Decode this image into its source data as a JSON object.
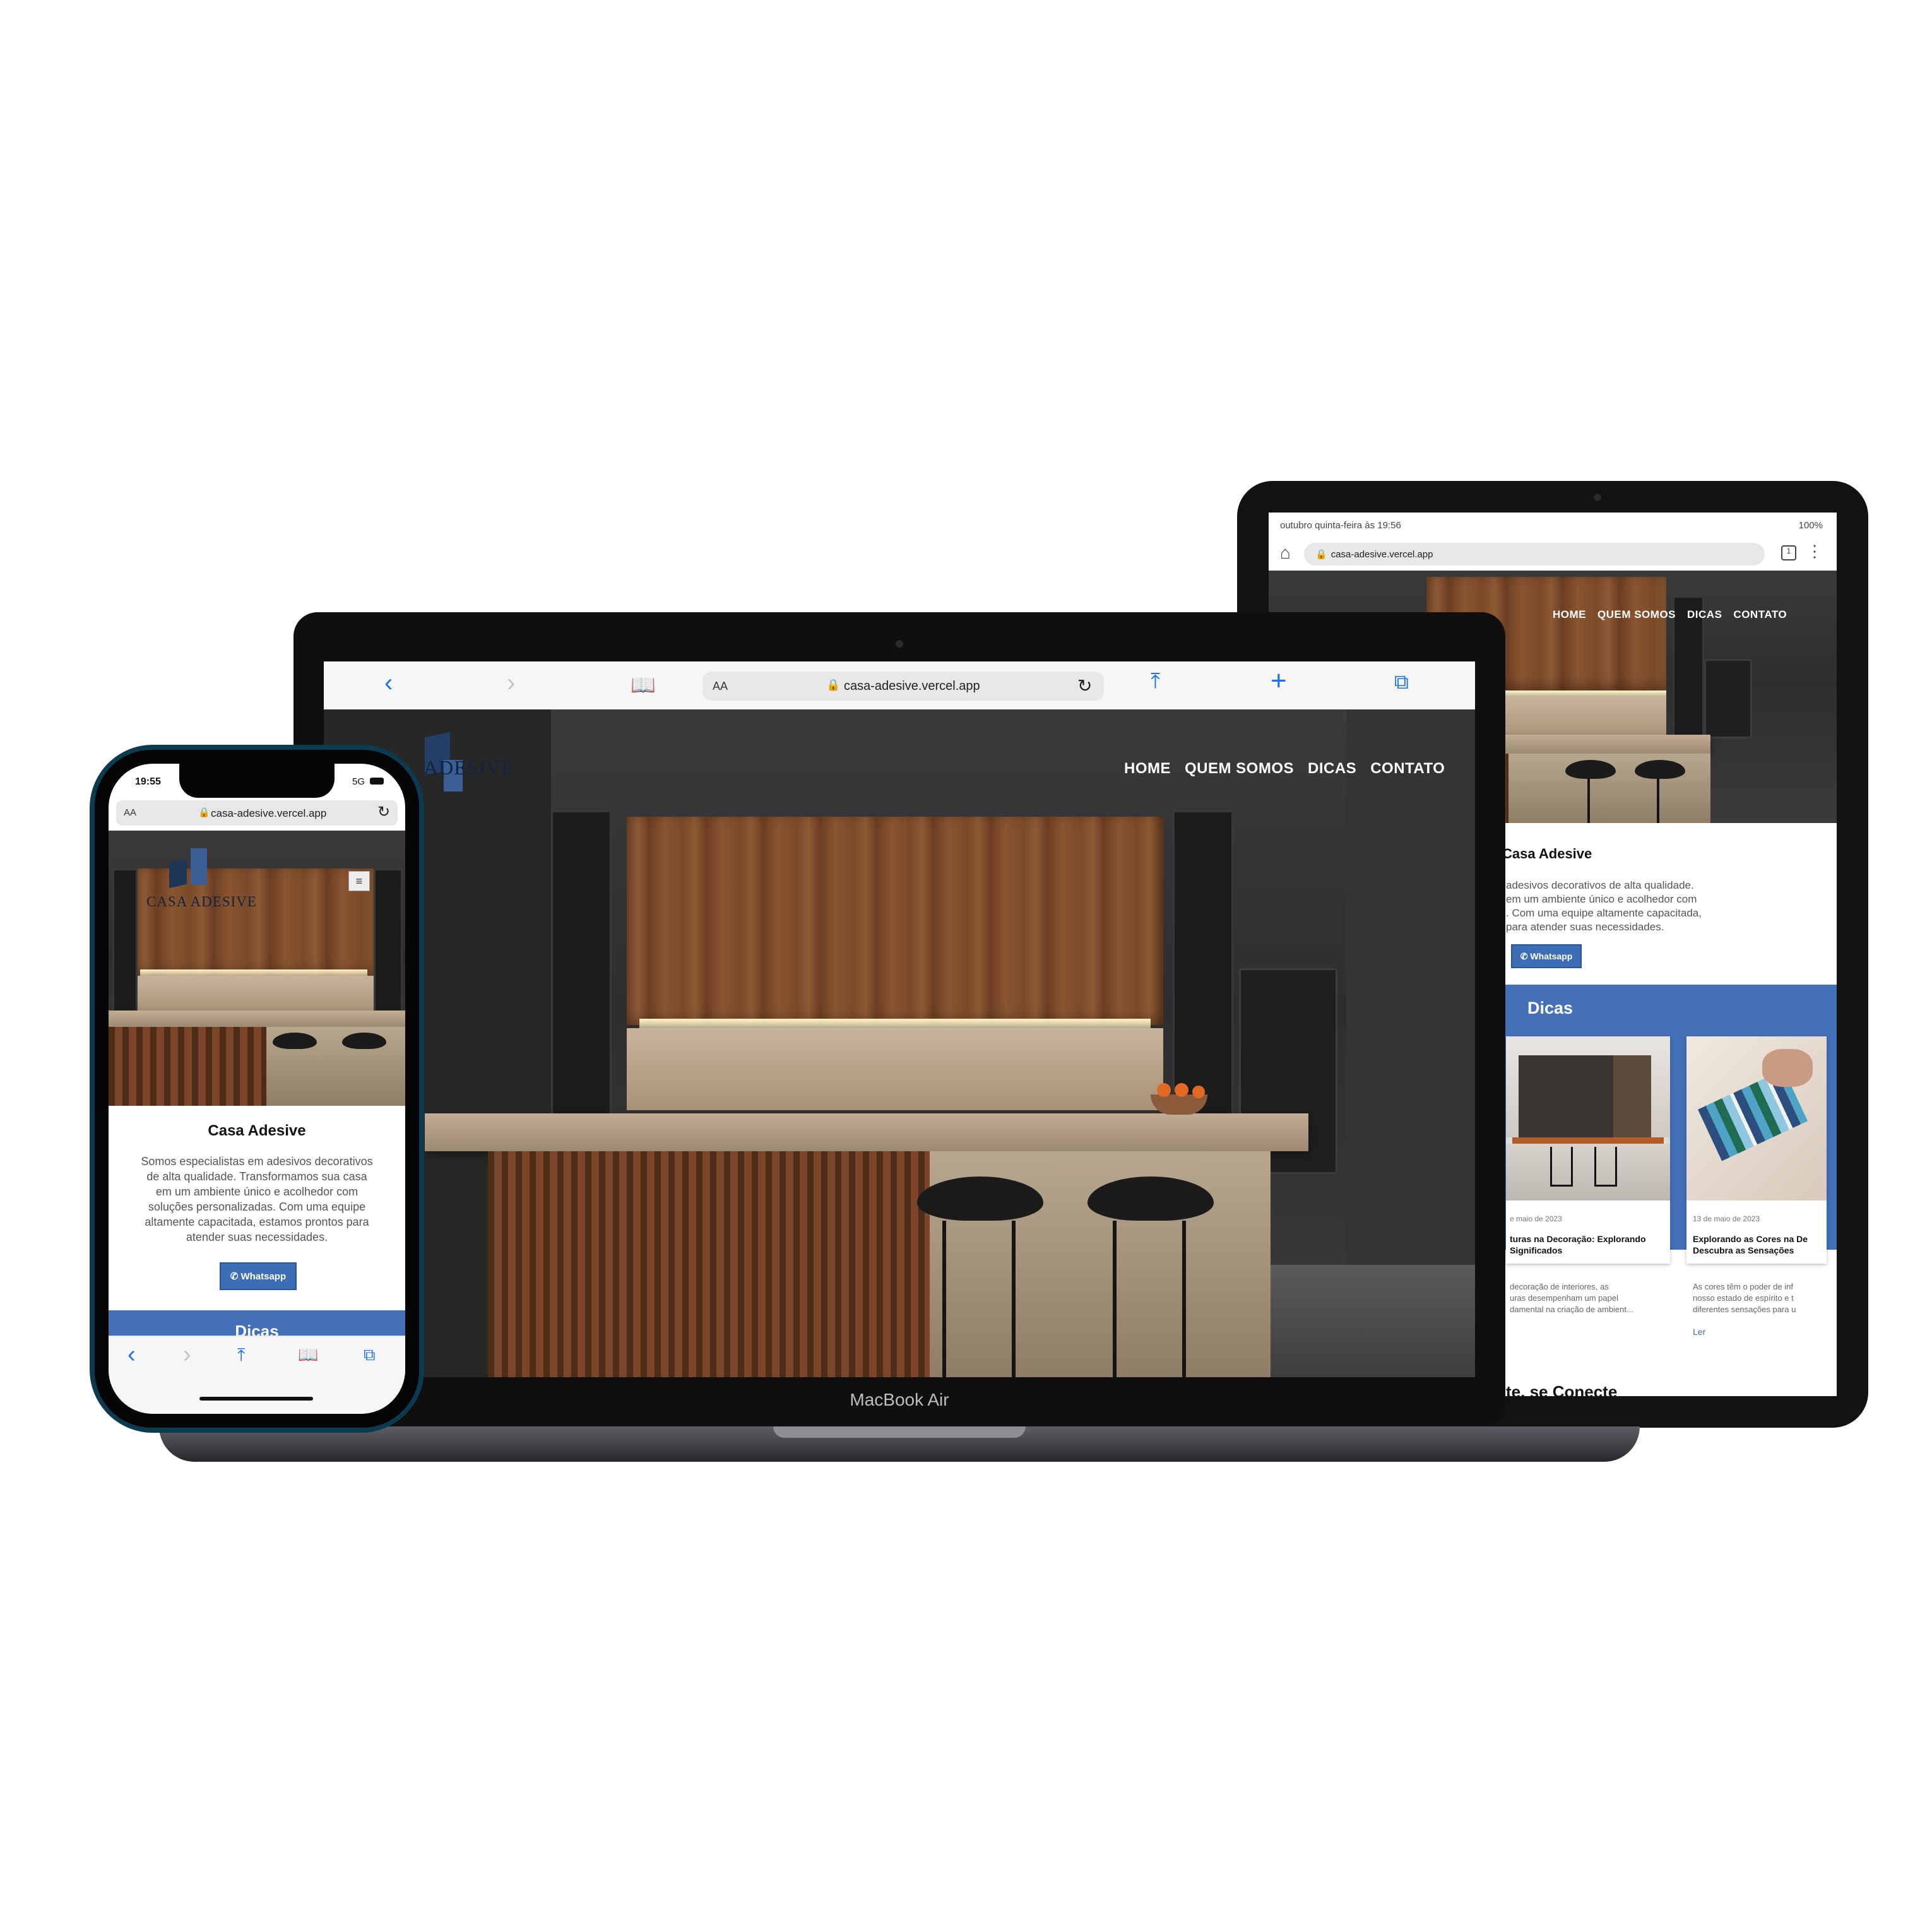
{
  "site": {
    "url": "casa-adesive.vercel.app",
    "brand": "CASA ADESIVE",
    "brand_partial": "ADESIVE",
    "nav": [
      "HOME",
      "QUEM SOMOS",
      "DICAS",
      "CONTATO"
    ],
    "title": "Casa Adesive",
    "description_full": "Somos especialistas em adesivos decorativos de alta qualidade. Transformamos sua casa em um ambiente único e acolhedor com soluções personalizadas. Com uma equipe altamente capacitada, estamos prontos para atender suas necessidades.",
    "whatsapp_label": "Whatsapp",
    "section_dicas": "Dicas",
    "colors": {
      "accent": "#4470b8",
      "button": "#3d6db5"
    }
  },
  "laptop": {
    "label": "MacBook Air",
    "safari": {
      "aa": "AA",
      "url": "casa-adesive.vercel.app"
    }
  },
  "tablet": {
    "status_left": "outubro quinta-feira às 19:56",
    "status_right": "100%",
    "url": "casa-adesive.vercel.app",
    "about_lines": [
      "adesivos decorativos de alta qualidade.",
      "em um ambiente único e acolhedor com",
      ". Com uma equipe altamente capacitada,",
      "para atender suas necessidades."
    ],
    "cards": [
      {
        "date": "e maio de 2023",
        "title_l1": "turas na Decoração: Explorando",
        "title_l2": "Significados",
        "text_l1": "decoração de interiores, as",
        "text_l2": "uras desempenham um papel",
        "text_l3": "damental na criação de ambient..."
      },
      {
        "date": "13 de maio de 2023",
        "title_l1": "Explorando as Cores na De",
        "title_l2": "Descubra as Sensações",
        "text_l1": "As cores têm o poder de inf",
        "text_l2": "nosso estado de espírito e t",
        "text_l3": "diferentes sensações para u",
        "link": "Ler"
      }
    ],
    "next_section_partial": "te, se Conecte"
  },
  "phone": {
    "time": "19:55",
    "network": "5G",
    "aa": "AA",
    "url": "casa-adesive.vercel.app",
    "description_lines": [
      "Somos especialistas em adesivos decorativos",
      "de alta qualidade. Transformamos sua casa",
      "em um ambiente único e acolhedor com",
      "soluções personalizadas. Com uma equipe",
      "altamente capacitada, estamos prontos para",
      "atender suas necessidades."
    ],
    "section_partial": "Dicas"
  }
}
